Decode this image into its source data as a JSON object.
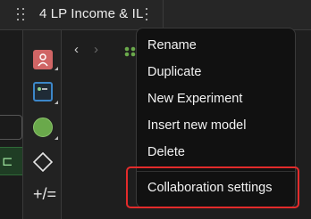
{
  "tab": {
    "title": "4 LP Income & IL"
  },
  "navigation": {
    "back_glyph": "‹",
    "forward_glyph": "›"
  },
  "left_panel": {
    "row_glyph": "⊏"
  },
  "toolbar": {
    "tools": [
      {
        "name": "person-tool-icon"
      },
      {
        "name": "table-tool-icon"
      },
      {
        "name": "circle-tool-icon"
      },
      {
        "name": "diamond-tool-icon"
      },
      {
        "name": "formula-tool-icon",
        "glyph": "+/="
      }
    ]
  },
  "context_menu": {
    "items": [
      "Rename",
      "Duplicate",
      "New Experiment",
      "Insert new model",
      "Delete",
      "Collaboration settings"
    ]
  },
  "colors": {
    "annotation_box": "#e32b2b",
    "menu_background": "#111111",
    "person_tool": "#d06565",
    "circle_tool": "#6aa94b",
    "table_tool": "#3c87c9"
  }
}
